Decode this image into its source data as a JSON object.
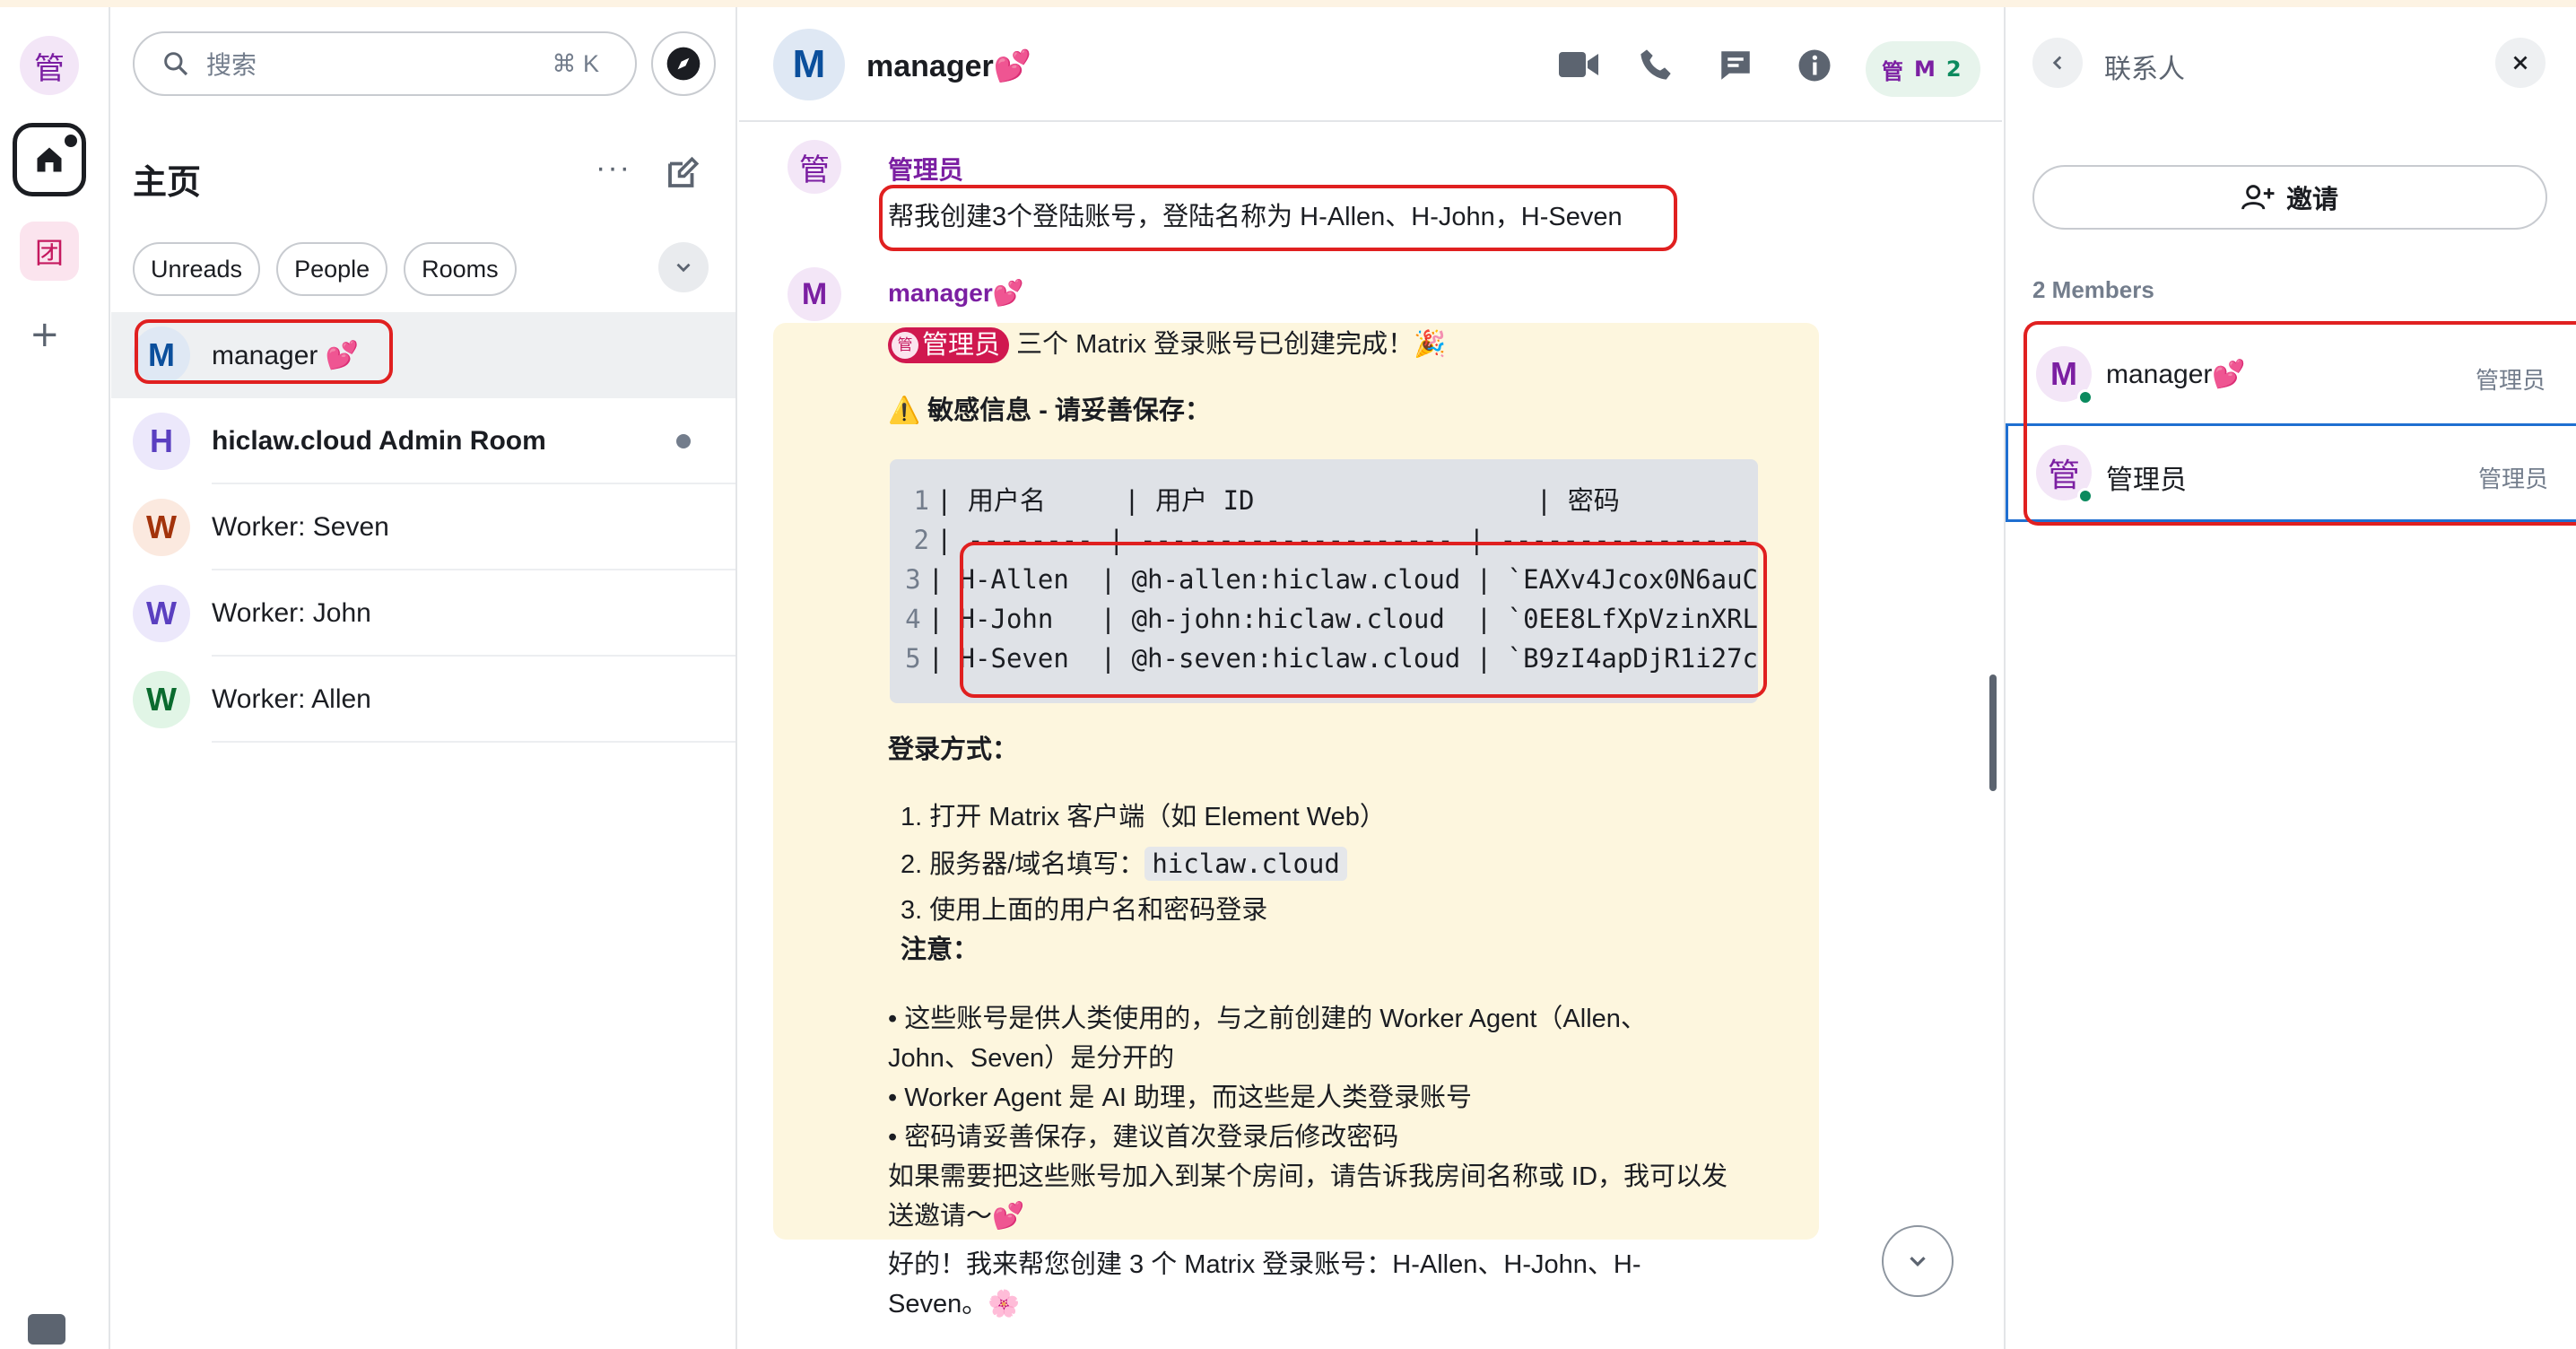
{
  "space_bar": {
    "user_avatar": "管",
    "team_space_letter": "团",
    "add_label": "+"
  },
  "room_list": {
    "search_placeholder": "搜索",
    "search_shortcut": "⌘ K",
    "home_title": "主页",
    "more_label": "···",
    "filters": [
      "Unreads",
      "People",
      "Rooms"
    ],
    "rooms": [
      {
        "avatar": "M",
        "name": "manager",
        "heart": "💕",
        "avatar_color": "#0b4f9c",
        "avatar_bg": "#dfe8f4",
        "bold": false
      },
      {
        "avatar": "H",
        "name": "hiclaw.cloud Admin Room",
        "heart": "",
        "avatar_color": "#5a3fc0",
        "avatar_bg": "#ece8fb",
        "bold": true
      },
      {
        "avatar": "W",
        "name": "Worker: Seven",
        "heart": "",
        "avatar_color": "#a3330b",
        "avatar_bg": "#fbe9df",
        "bold": false
      },
      {
        "avatar": "W",
        "name": "Worker: John",
        "heart": "",
        "avatar_color": "#5a3fc0",
        "avatar_bg": "#ece8fb",
        "bold": false
      },
      {
        "avatar": "W",
        "name": "Worker: Allen",
        "heart": "",
        "avatar_color": "#0a6b2e",
        "avatar_bg": "#e1f5e6",
        "bold": false
      }
    ]
  },
  "room_header": {
    "avatar": "M",
    "name": "manager",
    "heart": "💕",
    "face_pile_1": "管",
    "face_pile_2": "M",
    "member_count": "2"
  },
  "timeline": {
    "msg1": {
      "avatar": "管",
      "sender": "管理员",
      "body": "帮我创建3个登陆账号，登陆名称为 H-Allen、H-John，H-Seven"
    },
    "msg2": {
      "avatar": "M",
      "sender": "manager",
      "heart": "💕",
      "mention": "管理员",
      "mention_avatar": "管",
      "line1": "三个 Matrix 登录账号已创建完成！🎉",
      "warning": "⚠️ 敏感信息 - 请妥善保存：",
      "code_lines": [
        {
          "n": "1",
          "t": "| 用户名     | 用户 ID                  | 密码"
        },
        {
          "n": "2",
          "t": "| -------- | -------------------- | ----------------"
        },
        {
          "n": "3",
          "t": "| H-Allen  | @h-allen:hiclaw.cloud | `EAXv4Jcox0N6auC"
        },
        {
          "n": "4",
          "t": "| H-John   | @h-john:hiclaw.cloud  | `0EE8LfXpVzinXRL"
        },
        {
          "n": "5",
          "t": "| H-Seven  | @h-seven:hiclaw.cloud | `B9zI4apDjR1i27c"
        }
      ],
      "login_heading": "登录方式：",
      "step1": "1. 打开 Matrix 客户端（如 Element Web）",
      "step2_prefix": "2. 服务器/域名填写：",
      "step2_code": "hiclaw.cloud",
      "step3": "3. 使用上面的用户名和密码登录",
      "note_heading": "注意：",
      "note1a": "• 这些账号是供人类使用的，与之前创建的 Worker Agent（Allen、",
      "note1b": "John、Seven）是分开的",
      "note2": "• Worker Agent 是 AI 助理，而这些是人类登录账号",
      "note3": "• 密码请妥善保存，建议首次登录后修改密码",
      "closing_a": "如果需要把这些账号加入到某个房间，请告诉我房间名称或 ID，我可以发",
      "closing_b": "送邀请～💕"
    },
    "msg3": {
      "line_a": "好的！我来帮您创建 3 个 Matrix 登录账号：H-Allen、H-John、H-",
      "line_b": "Seven。🌸"
    }
  },
  "right_panel": {
    "title": "联系人",
    "invite_label": "邀请",
    "members_count": "2 Members",
    "members": [
      {
        "avatar": "M",
        "name": "manager",
        "heart": "💕",
        "role": "管理员"
      },
      {
        "avatar": "管",
        "name": "管理员",
        "heart": "",
        "role": "管理员"
      }
    ]
  },
  "colors": {
    "accent_green": "#0b8a5e",
    "highlight_red": "#e02020",
    "sender_purple": "#7b1fa2",
    "bubble_bg": "#fdf6de"
  }
}
